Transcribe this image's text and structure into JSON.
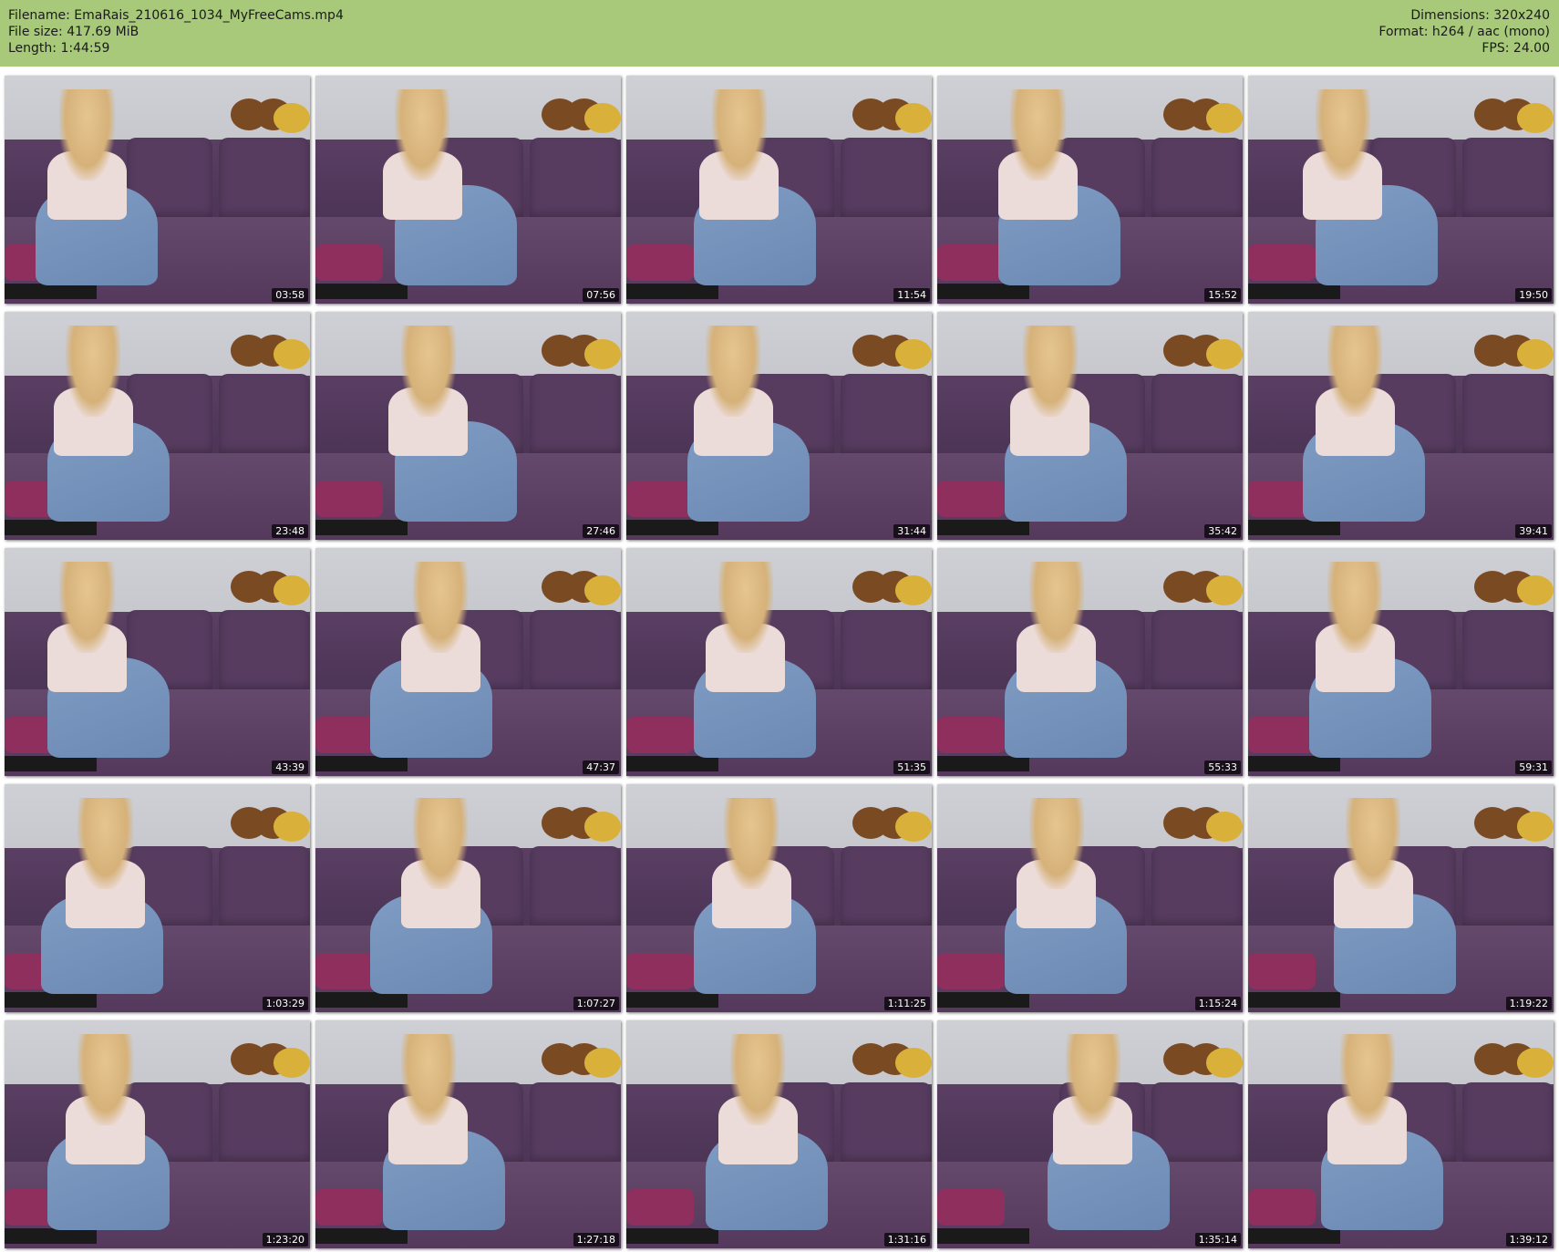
{
  "header": {
    "filename_line": "Filename: EmaRais_210616_1034_MyFreeCams.mp4",
    "filesize_line": "File size: 417.69 MiB",
    "length_line": "Length: 1:44:59",
    "dimensions_line": "Dimensions: 320x240",
    "format_line": "Format: h264 / aac (mono)",
    "fps_line": "FPS: 24.00"
  },
  "header_color": "#a8c97a",
  "thumbnails": [
    {
      "time": "03:58"
    },
    {
      "time": "07:56"
    },
    {
      "time": "11:54"
    },
    {
      "time": "15:52"
    },
    {
      "time": "19:50"
    },
    {
      "time": "23:48"
    },
    {
      "time": "27:46"
    },
    {
      "time": "31:44"
    },
    {
      "time": "35:42"
    },
    {
      "time": "39:41"
    },
    {
      "time": "43:39"
    },
    {
      "time": "47:37"
    },
    {
      "time": "51:35"
    },
    {
      "time": "55:33"
    },
    {
      "time": "59:31"
    },
    {
      "time": "1:03:29"
    },
    {
      "time": "1:07:27"
    },
    {
      "time": "1:11:25"
    },
    {
      "time": "1:15:24"
    },
    {
      "time": "1:19:22"
    },
    {
      "time": "1:23:20"
    },
    {
      "time": "1:27:18"
    },
    {
      "time": "1:31:16"
    },
    {
      "time": "1:35:14"
    },
    {
      "time": "1:39:12"
    }
  ]
}
